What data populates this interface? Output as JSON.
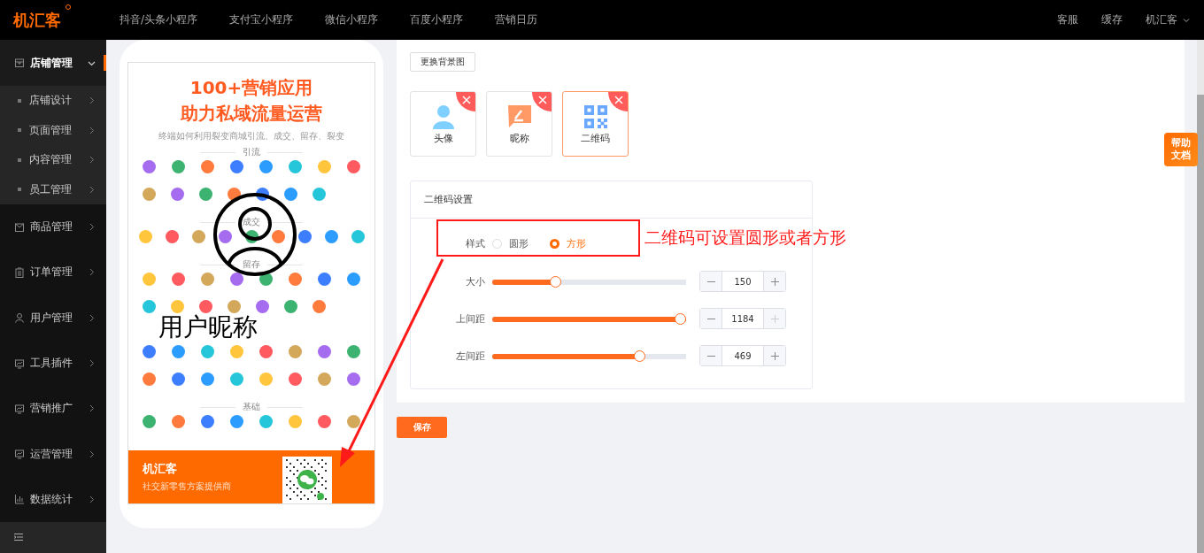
{
  "app": {
    "logo": "机汇客"
  },
  "top_nav": {
    "items": [
      {
        "label": "抖音/头条小程序"
      },
      {
        "label": "支付宝小程序"
      },
      {
        "label": "微信小程序"
      },
      {
        "label": "百度小程序"
      },
      {
        "label": "营销日历"
      }
    ],
    "right_items": [
      {
        "label": "客服"
      },
      {
        "label": "缓存"
      }
    ],
    "account": "机汇客"
  },
  "sidebar": {
    "items": [
      {
        "label": "店铺管理",
        "expanded": true,
        "selected": true,
        "children": [
          {
            "label": "店铺设计"
          },
          {
            "label": "页面管理"
          },
          {
            "label": "内容管理"
          },
          {
            "label": "员工管理"
          }
        ]
      },
      {
        "label": "商品管理",
        "expanded": false,
        "selected": false
      },
      {
        "label": "订单管理",
        "expanded": false,
        "selected": false
      },
      {
        "label": "用户管理",
        "expanded": false,
        "selected": false
      },
      {
        "label": "工具插件",
        "expanded": false,
        "selected": false
      },
      {
        "label": "营销推广",
        "expanded": false,
        "selected": false
      },
      {
        "label": "运营管理",
        "expanded": false,
        "selected": false
      },
      {
        "label": "数据统计",
        "expanded": false,
        "selected": false
      }
    ]
  },
  "preview": {
    "poster": {
      "headline": [
        "100+营销应用",
        "助力私域流量运营"
      ],
      "subtitle": "终端如何利用裂变商城引流、成交、留存、裂变",
      "sections": [
        {
          "label": "引流"
        },
        {
          "label": "成交"
        },
        {
          "label": "留存"
        },
        {
          "label": "基础"
        }
      ],
      "footer": {
        "brand": "机汇客",
        "tagline": "社交新零售方案提供商"
      }
    },
    "nickname": "用户昵称"
  },
  "background_button": "更换背景图",
  "elements": [
    {
      "label": "头像",
      "selected": false
    },
    {
      "label": "昵称",
      "selected": false
    },
    {
      "label": "二维码",
      "selected": true
    }
  ],
  "settings": {
    "title": "二维码设置",
    "style": {
      "label": "样式",
      "options": [
        {
          "label": "圆形",
          "selected": false
        },
        {
          "label": "方形",
          "selected": true
        }
      ]
    },
    "sliders": [
      {
        "label": "大小",
        "level": 0.315,
        "value": "150",
        "plus_disabled": false
      },
      {
        "label": "上间距",
        "level": 1.0,
        "value": "1184",
        "plus_disabled": true
      },
      {
        "label": "左间距",
        "level": 0.776,
        "value": "469",
        "plus_disabled": false
      }
    ]
  },
  "save_button": "保存",
  "help_button": "帮助文档",
  "annotation": {
    "text": "二维码可设置圆形或者方形"
  }
}
